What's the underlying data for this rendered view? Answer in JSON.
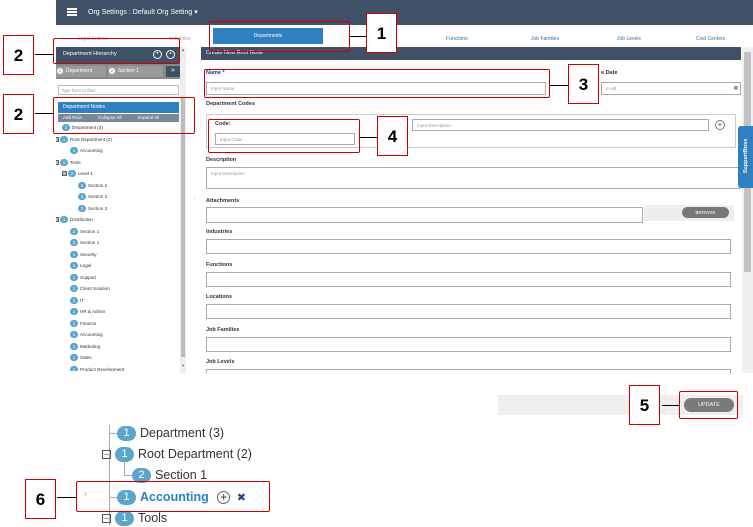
{
  "topbar": {
    "title": "Org Settings : Default Org Setting",
    "caret": "▾"
  },
  "tabs": [
    {
      "label": "Legal Entities"
    },
    {
      "label": "Industries"
    },
    {
      "label": "Departments"
    },
    {
      "label": "Functions"
    },
    {
      "label": "Job Families"
    },
    {
      "label": "Job Levels"
    },
    {
      "label": "Cost Centers"
    }
  ],
  "left": {
    "hierarchy_title": "Department Hierarchy",
    "tab_department": "Department",
    "tab_department_num": "1",
    "tab_section": "Section 1",
    "tab_section_num": "2",
    "expand_glyph": "»",
    "filter_placeholder": "Type here to filter",
    "nodes_title": "Department Nodes",
    "btn_add_root": "Add Root",
    "btn_collapse": "Collapse All",
    "btn_expand": "Expand All",
    "tree": [
      {
        "badge": "1",
        "label": "Department (3)"
      },
      {
        "badge": "1",
        "label": "Root Department (2)",
        "exp": "⊟"
      },
      {
        "badge": "1",
        "label": "Accounting"
      },
      {
        "badge": "1",
        "label": "Tools",
        "exp": "⊟"
      },
      {
        "badge": "2",
        "label": "Level 1",
        "exp": "⊟"
      },
      {
        "badge": "3",
        "label": "Section 2"
      },
      {
        "badge": "3",
        "label": "Section 2"
      },
      {
        "badge": "3",
        "label": "Section 2"
      },
      {
        "badge": "1",
        "label": "Distribution",
        "exp": "⊟"
      },
      {
        "badge": "2",
        "label": "Section 1"
      },
      {
        "badge": "2",
        "label": "Section 1"
      },
      {
        "badge": "1",
        "label": "Security"
      },
      {
        "badge": "1",
        "label": "Legal"
      },
      {
        "badge": "1",
        "label": "Support"
      },
      {
        "badge": "1",
        "label": "Client Solution"
      },
      {
        "badge": "1",
        "label": "IT"
      },
      {
        "badge": "1",
        "label": "HR & Admin"
      },
      {
        "badge": "1",
        "label": "Finance"
      },
      {
        "badge": "1",
        "label": "Accounting"
      },
      {
        "badge": "1",
        "label": "Marketing"
      },
      {
        "badge": "1",
        "label": "Sales"
      },
      {
        "badge": "1",
        "label": "Product Development"
      }
    ]
  },
  "form": {
    "header": "Create New Root Node",
    "name_label": "Name *",
    "name_placeholder": "Input Name",
    "date_label": "e Date",
    "date_placeholder": "m-dd",
    "codes_label": "Department Codes",
    "code_label": "Code:",
    "code_placeholder": "Input Code",
    "code_desc_placeholder": "Input Description",
    "description_label": "Description",
    "description_placeholder": "Input Description",
    "attachments_label": "Attachments",
    "browse_label": "BROWSE",
    "industries_label": "Industries",
    "functions_label": "Functions",
    "locations_label": "Locations",
    "job_families_label": "Job Families",
    "job_levels_label": "Job Levels"
  },
  "supportboss": "SupportBoss",
  "update_label": "UPDATE",
  "zoom": {
    "rows": [
      {
        "badge": "1",
        "label": "Department (3)"
      },
      {
        "badge": "1",
        "label": "Root Department (2)",
        "exp": "−"
      },
      {
        "badge": "2",
        "label": "Section 1"
      },
      {
        "badge": "1",
        "label": "Accounting"
      },
      {
        "badge": "1",
        "label": "Tools",
        "exp": "−"
      }
    ],
    "add_glyph": "+",
    "delete_glyph": "✖",
    "chevron": "›"
  },
  "callouts": [
    "1",
    "2",
    "2",
    "3",
    "4",
    "5",
    "6"
  ],
  "colors": {
    "accent": "#2f7fc1",
    "header": "#3f5166",
    "badge": "#5aa5c9",
    "callout": "#cc0000"
  }
}
